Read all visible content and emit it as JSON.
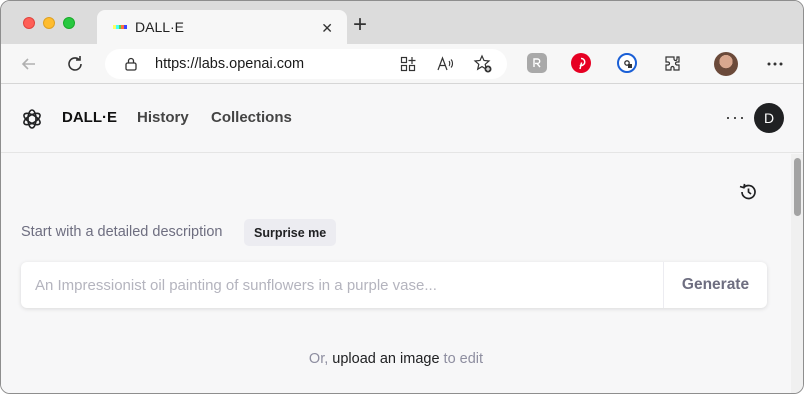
{
  "browser": {
    "tab": {
      "title": "DALL·E",
      "close": "✕"
    },
    "newtab": "+",
    "url": "https://labs.openai.com"
  },
  "app": {
    "nav": {
      "brand": "DALL·E",
      "history": "History",
      "collections": "Collections"
    },
    "more": "···",
    "avatar_initial": "D"
  },
  "main": {
    "prompt_label": "Start with a detailed description",
    "surprise_label": "Surprise me",
    "prompt_placeholder": "An Impressionist oil painting of sunflowers in a purple vase...",
    "generate_label": "Generate",
    "upload_prefix": "Or, ",
    "upload_link": "upload an image",
    "upload_suffix": " to edit"
  },
  "colors": {
    "accent_dark": "#202123",
    "muted_text": "#6e6e80"
  },
  "icons": [
    "back-icon",
    "refresh-icon",
    "lock-icon",
    "reader-view-icon",
    "read-aloud-icon",
    "add-favorite-icon",
    "extension-r-icon",
    "pinterest-icon",
    "password-manager-icon",
    "extensions-icon",
    "more-icon",
    "openai-logo-icon",
    "history-icon"
  ]
}
